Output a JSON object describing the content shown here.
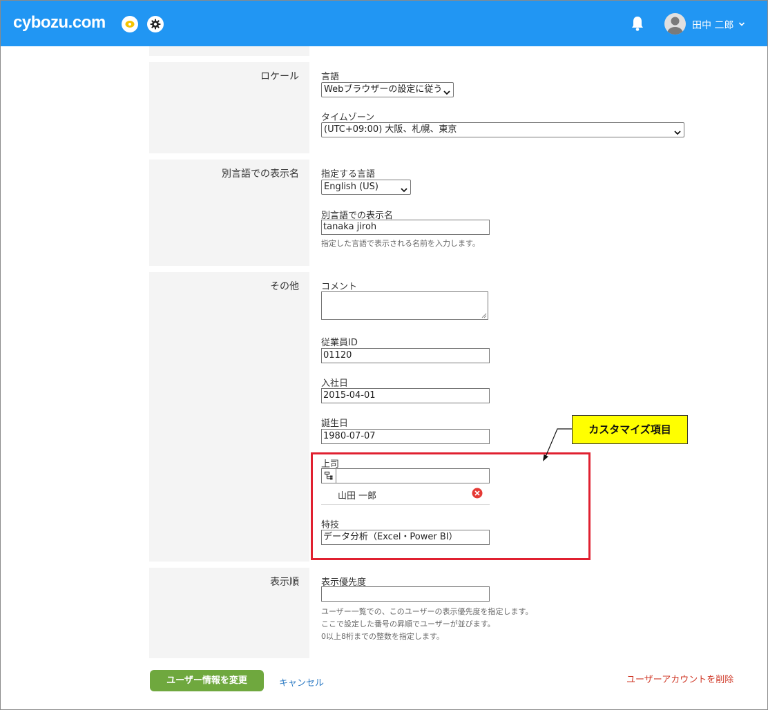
{
  "header": {
    "logo": "cybozu.com",
    "user_name": "田中 二郎"
  },
  "icons": {
    "app": "cybozu-app-icon",
    "settings": "gear-icon",
    "notifications": "bell-icon",
    "avatar": "user-avatar",
    "dropdown": "chevron-down-icon"
  },
  "sections": {
    "locale": {
      "label": "ロケール",
      "language_label": "言語",
      "language_value": "Webブラウザーの設定に従う",
      "timezone_label": "タイムゾーン",
      "timezone_value": "(UTC+09:00) 大阪、札幌、東京"
    },
    "alt_name": {
      "label": "別言語での表示名",
      "lang_label": "指定する言語",
      "lang_value": "English (US)",
      "name_label": "別言語での表示名",
      "name_value": "tanaka jiroh",
      "help": "指定した言語で表示される名前を入力します。"
    },
    "other": {
      "label": "その他",
      "comment_label": "コメント",
      "comment_value": "",
      "employee_id_label": "従業員ID",
      "employee_id_value": "01120",
      "join_date_label": "入社日",
      "join_date_value": "2015-04-01",
      "birthday_label": "誕生日",
      "birthday_value": "1980-07-07",
      "boss_label": "上司",
      "boss_input_value": "",
      "boss_selected": "山田 一郎",
      "skill_label": "特技",
      "skill_value": "データ分析（Excel・Power BI）"
    },
    "order": {
      "label": "表示順",
      "priority_label": "表示優先度",
      "priority_value": "",
      "help_lines": [
        "ユーザー一覧での、このユーザーの表示優先度を指定します。",
        "ここで設定した番号の昇順でユーザーが並びます。",
        "0以上8桁までの整数を指定します。"
      ]
    }
  },
  "annotation": {
    "callout": "カスタマイズ項目",
    "highlight_color": "#e02030",
    "callout_color": "#ffff00"
  },
  "actions": {
    "submit": "ユーザー情報を変更",
    "cancel": "キャンセル",
    "delete": "ユーザーアカウントを削除"
  },
  "colors": {
    "header": "#2196f3",
    "primary_button": "#6fa83e",
    "link": "#2d7bc4",
    "danger_link": "#d03b2a"
  }
}
